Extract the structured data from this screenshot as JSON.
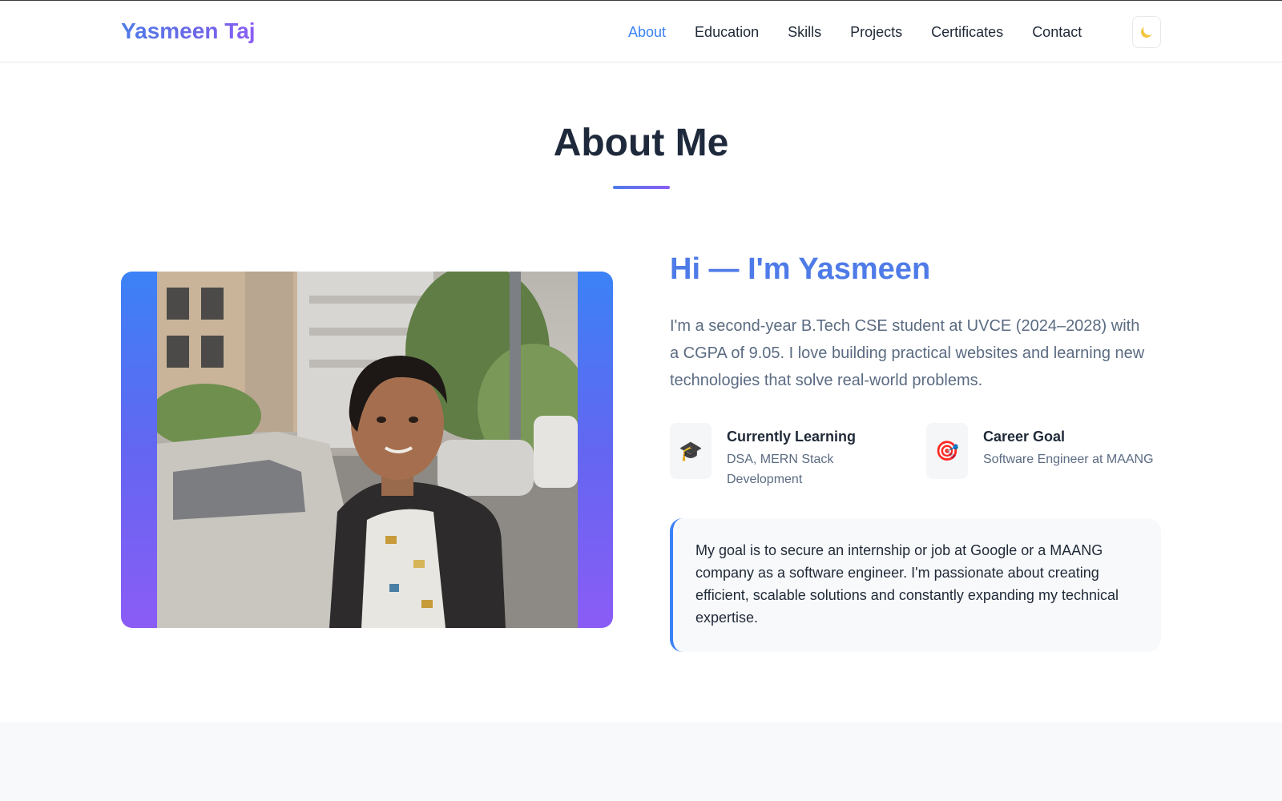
{
  "header": {
    "logo": "Yasmeen Taj",
    "nav": [
      {
        "label": "About",
        "active": true
      },
      {
        "label": "Education",
        "active": false
      },
      {
        "label": "Skills",
        "active": false
      },
      {
        "label": "Projects",
        "active": false
      },
      {
        "label": "Certificates",
        "active": false
      },
      {
        "label": "Contact",
        "active": false
      }
    ],
    "theme_toggle_icon": "moon-icon"
  },
  "about": {
    "section_title": "About Me",
    "greeting": "Hi — I'm Yasmeen",
    "bio": "I'm a second-year B.Tech CSE student at UVCE (2024–2028) with a CGPA of 9.05. I love building practical websites and learning new technologies that solve real-world problems.",
    "cards": [
      {
        "icon": "graduation-cap-icon",
        "title": "Currently Learning",
        "subtitle": "DSA, MERN Stack Development"
      },
      {
        "icon": "target-icon",
        "title": "Career Goal",
        "subtitle": "Software Engineer at MAANG"
      }
    ],
    "quote": "My goal is to secure an internship or job at Google or a MAANG company as a software engineer. I'm passionate about creating efficient, scalable solutions and constantly expanding my technical expertise."
  },
  "colors": {
    "accent": "#4f7be8",
    "accent_purple": "#8b5cf6",
    "active_nav": "#3b82f6",
    "heading": "#1e293b",
    "muted_text": "#5b6b82"
  }
}
